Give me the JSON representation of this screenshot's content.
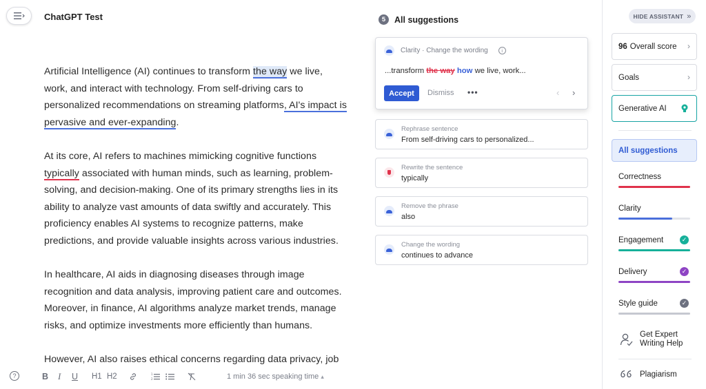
{
  "document": {
    "title": "ChatGPT Test",
    "paragraphs": [
      {
        "p1_a": "Artificial Intelligence (AI) continues to transform ",
        "p1_sel": "the way",
        "p1_b": " we live, work, and interact with technology. From self-driving cars to personalized recommendations on streaming platforms",
        "p1_ul": ", AI's impact is pervasive and ever-expanding",
        "p1_c": "."
      }
    ],
    "p2_a": "At its core, AI refers to machines mimicking cognitive functions ",
    "p2_ul": "typically",
    "p2_b": " associated with human minds, such as learning, problem-solving, and decision-making. One of its primary strengths lies in its ability to analyze vast amounts of data swiftly and accurately. This proficiency enables AI systems to recognize patterns, make predictions, and provide valuable insights across various industries.",
    "p3": "In healthcare, AI aids in diagnosing diseases through image recognition and data analysis, improving patient care and outcomes. Moreover, in finance, AI algorithms analyze market trends, manage risks, and optimize investments more efficiently than humans.",
    "p4": "However, AI also raises ethical concerns regarding data privacy, job displacement, and algorithmic biases."
  },
  "toolbar": {
    "bold": "B",
    "italic": "I",
    "underline": "U",
    "h1": "H1",
    "h2": "H2",
    "speaking_time": "1 min 36 sec speaking time",
    "caret": "▴",
    "help": "?"
  },
  "suggestions": {
    "count": "5",
    "title": "All suggestions",
    "main": {
      "category": "Clarity · Change the wording",
      "info": "i",
      "text_before": "...transform ",
      "text_removed": "the way",
      "text_added": "how",
      "text_after": " we live, work...",
      "accept": "Accept",
      "dismiss": "Dismiss",
      "more": "•••"
    },
    "items": [
      {
        "label": "Rephrase sentence",
        "text": "From self-driving cars to personalized..."
      },
      {
        "label": "Rewrite the sentence",
        "text": "typically"
      },
      {
        "label": "Remove the phrase",
        "text": "also"
      },
      {
        "label": "Change the wording",
        "text": "continues to advance"
      }
    ]
  },
  "assistant": {
    "hide": "HIDE ASSISTANT",
    "score_value": "96",
    "score_label": "Overall score",
    "goals": "Goals",
    "generative_ai": "Generative AI",
    "all_suggestions": "All suggestions",
    "categories": [
      {
        "name": "Correctness",
        "color": "#e0324b",
        "fill": 1.0
      },
      {
        "name": "Clarity",
        "color": "#4a6fdb",
        "fill": 0.75
      },
      {
        "name": "Engagement",
        "color": "#16b09a",
        "fill": 1.0
      },
      {
        "name": "Delivery",
        "color": "#8e44c4",
        "fill": 1.0
      },
      {
        "name": "Style guide",
        "color": "#6d7180",
        "fill": 1.0
      }
    ],
    "expert": "Get Expert Writing Help",
    "plagiarism": "Plagiarism"
  }
}
